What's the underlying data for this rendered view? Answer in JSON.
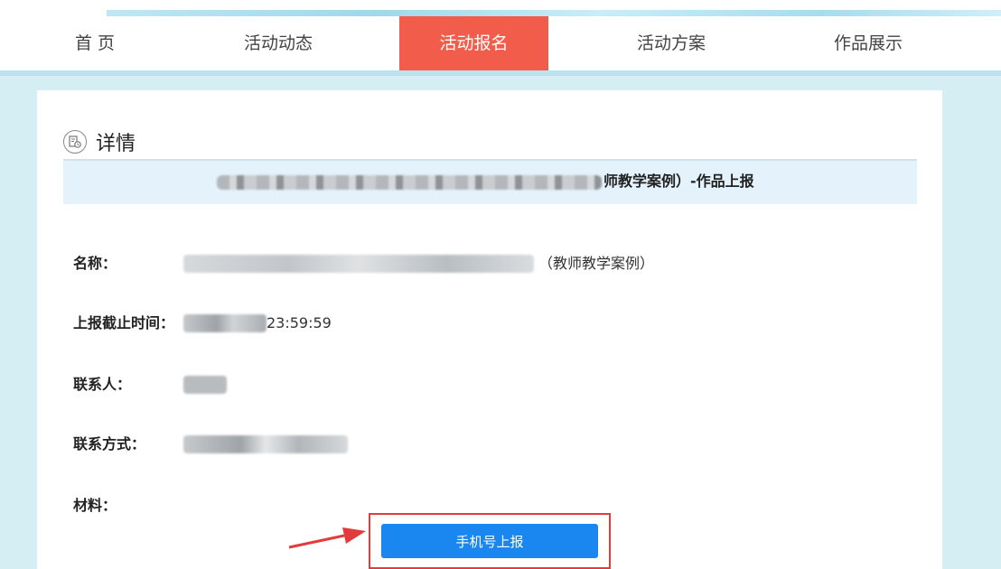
{
  "nav": {
    "items": [
      {
        "label": "首 页"
      },
      {
        "label": "活动动态"
      },
      {
        "label": "活动报名",
        "active": true
      },
      {
        "label": "活动方案"
      },
      {
        "label": "作品展示"
      }
    ]
  },
  "detail": {
    "heading": "详情",
    "icon": "document-clock-icon",
    "title_suffix": "师教学案例）-作品上报"
  },
  "fields": {
    "name_label": "名称：",
    "name_suffix": "（教师教学案例）",
    "deadline_label": "上报截止时间：",
    "deadline_suffix": "23:59:59",
    "contact_label": "联系人：",
    "phone_label": "联系方式：",
    "material_label": "材料："
  },
  "actions": {
    "submit_label": "手机号上报"
  },
  "colors": {
    "nav_active": "#f25c4a",
    "button": "#1a86f0",
    "highlight": "#e23b3b",
    "band": "#d4eef4"
  }
}
